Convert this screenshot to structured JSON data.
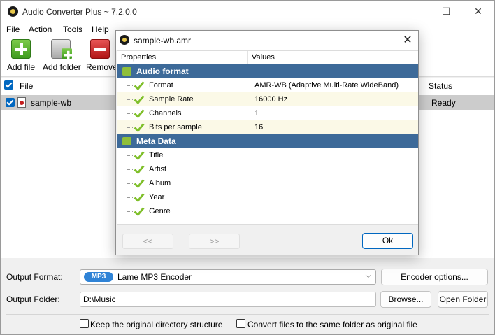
{
  "window": {
    "title": "Audio Converter Plus ~ 7.2.0.0",
    "min_glyph": "—",
    "max_glyph": "☐",
    "close_glyph": "✕"
  },
  "menu": [
    "File",
    "Action",
    "Tools",
    "Help"
  ],
  "toolbar": {
    "add_file": "Add file",
    "add_folder": "Add folder",
    "remove": "Remove"
  },
  "file_list": {
    "columns": {
      "file": "File",
      "status": "Status"
    },
    "rows": [
      {
        "name": "sample-wb",
        "status": "Ready",
        "checked": true
      }
    ]
  },
  "output": {
    "format_label": "Output Format:",
    "format_badge": "MP3",
    "format_value": "Lame MP3 Encoder",
    "encoder_options": "Encoder options...",
    "folder_label": "Output Folder:",
    "folder_value": "D:\\Music",
    "browse": "Browse...",
    "open_folder": "Open Folder",
    "keep_structure": "Keep the original directory structure",
    "same_folder": "Convert files to the same folder as original file"
  },
  "dialog": {
    "title": "sample-wb.amr",
    "close_glyph": "✕",
    "col_properties": "Properties",
    "col_values": "Values",
    "groups": [
      {
        "label": "Audio format",
        "rows": [
          {
            "name": "Format",
            "value": "AMR-WB (Adaptive Multi-Rate WideBand)"
          },
          {
            "name": "Sample Rate",
            "value": "16000 Hz"
          },
          {
            "name": "Channels",
            "value": "1"
          },
          {
            "name": "Bits per sample",
            "value": "16"
          }
        ]
      },
      {
        "label": "Meta Data",
        "rows": [
          {
            "name": "Title",
            "value": ""
          },
          {
            "name": "Artist",
            "value": ""
          },
          {
            "name": "Album",
            "value": ""
          },
          {
            "name": "Year",
            "value": ""
          },
          {
            "name": "Genre",
            "value": ""
          }
        ]
      }
    ],
    "prev": "<<",
    "next": ">>",
    "ok": "Ok"
  }
}
